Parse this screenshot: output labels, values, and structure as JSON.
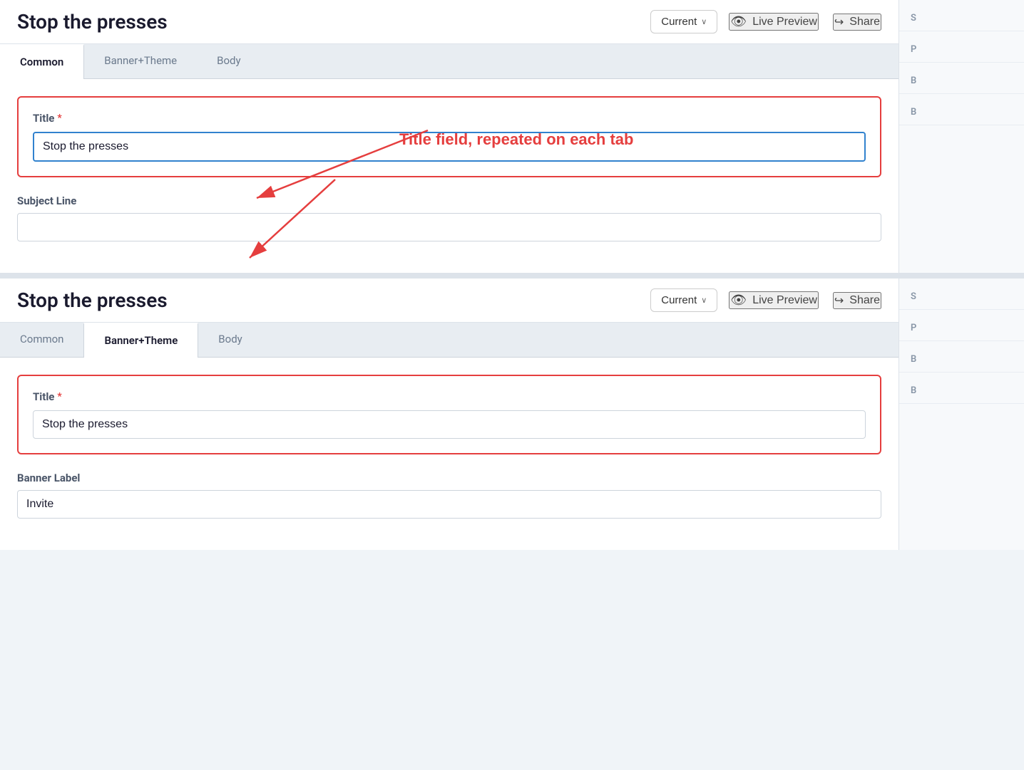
{
  "page": {
    "title": "Stop the presses"
  },
  "panel1": {
    "header": {
      "title": "Stop the presses",
      "version_label": "Current",
      "chevron": "∨",
      "live_preview_label": "Live Preview",
      "share_label": "Share"
    },
    "tabs": [
      {
        "id": "common",
        "label": "Common",
        "active": true
      },
      {
        "id": "banner-theme",
        "label": "Banner+Theme",
        "active": false
      },
      {
        "id": "body",
        "label": "Body",
        "active": false
      }
    ],
    "form": {
      "title_label": "Title",
      "title_required": "*",
      "title_value": "Stop the presses",
      "subject_line_label": "Subject Line",
      "subject_line_value": ""
    }
  },
  "panel2": {
    "header": {
      "title": "Stop the presses",
      "version_label": "Current",
      "chevron": "∨",
      "live_preview_label": "Live Preview",
      "share_label": "Share"
    },
    "tabs": [
      {
        "id": "common",
        "label": "Common",
        "active": false
      },
      {
        "id": "banner-theme",
        "label": "Banner+Theme",
        "active": true
      },
      {
        "id": "body",
        "label": "Body",
        "active": false
      }
    ],
    "form": {
      "title_label": "Title",
      "title_required": "*",
      "title_value": "Stop the presses",
      "banner_label": "Banner Label",
      "banner_value": "Invite"
    }
  },
  "annotation": {
    "text": "Title field, repeated on each tab"
  },
  "side_items": [
    {
      "label": "S"
    },
    {
      "label": "P"
    },
    {
      "label": "B"
    },
    {
      "label": "B"
    }
  ]
}
